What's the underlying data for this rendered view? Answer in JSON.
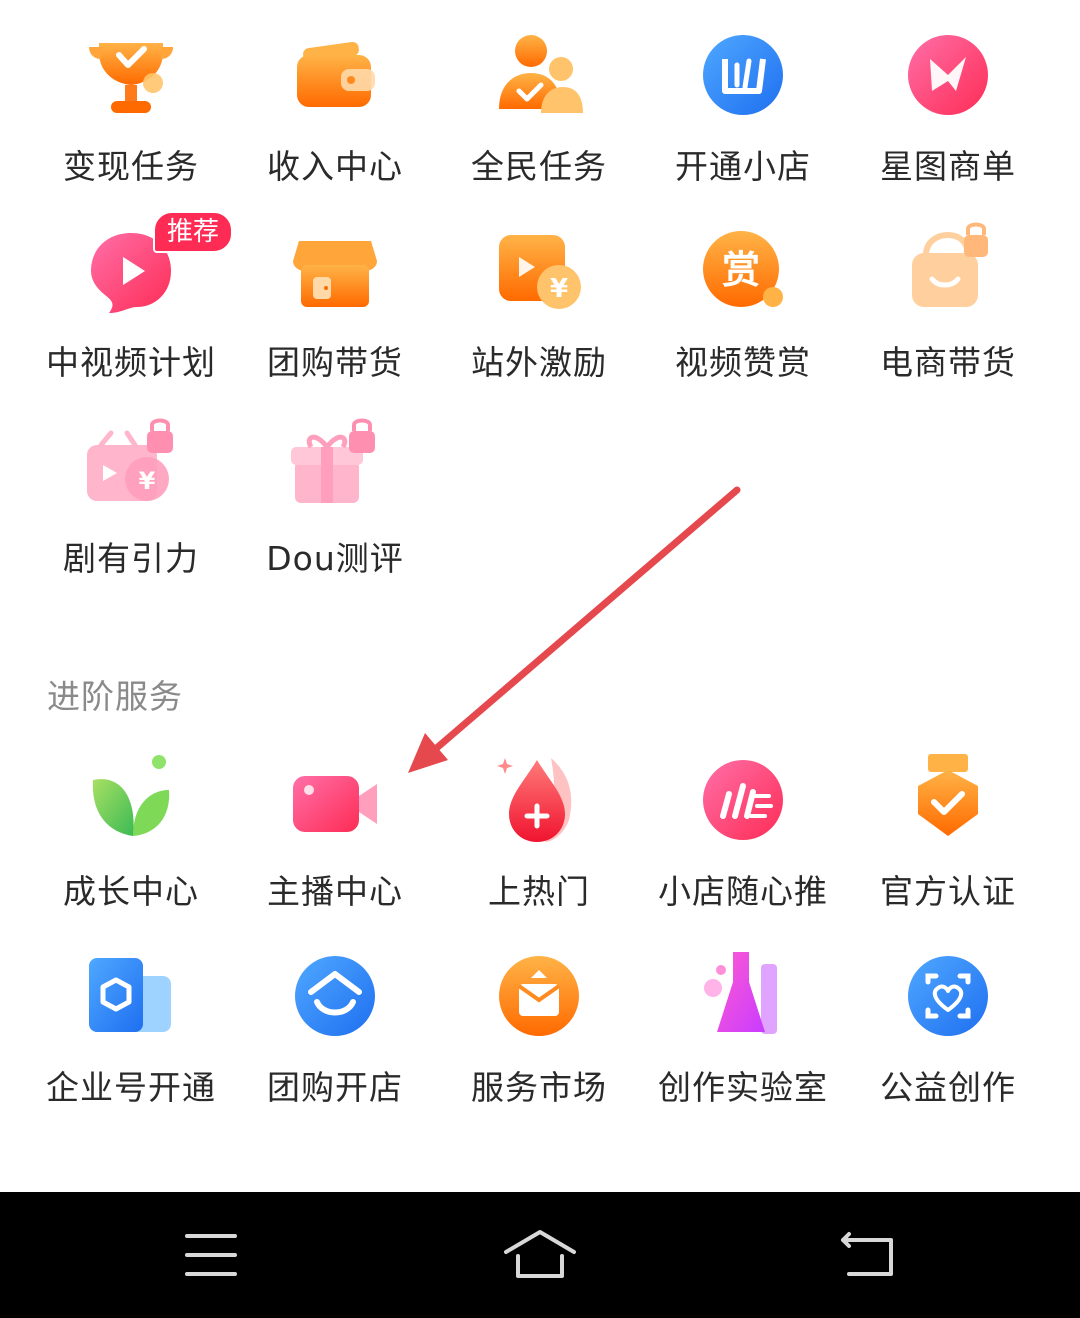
{
  "grid_top": {
    "row1": [
      {
        "label": "变现任务",
        "icon": "trophy-icon"
      },
      {
        "label": "收入中心",
        "icon": "wallet-icon"
      },
      {
        "label": "全民任务",
        "icon": "people-check-icon"
      },
      {
        "label": "开通小店",
        "icon": "shop-logo-icon"
      },
      {
        "label": "星图商单",
        "icon": "star-map-icon"
      }
    ],
    "row2": [
      {
        "label": "中视频计划",
        "icon": "play-bubble-icon",
        "badge": "推荐"
      },
      {
        "label": "团购带货",
        "icon": "storefront-icon"
      },
      {
        "label": "站外激励",
        "icon": "video-yen-icon"
      },
      {
        "label": "视频赞赏",
        "icon": "reward-coin-icon",
        "glyph": "赏"
      },
      {
        "label": "电商带货",
        "icon": "shopping-bag-lock-icon"
      }
    ],
    "row3": [
      {
        "label": "剧有引力",
        "icon": "drama-yen-lock-icon"
      },
      {
        "label": "Dou测评",
        "icon": "gift-lock-icon"
      }
    ]
  },
  "advanced": {
    "title": "进阶服务",
    "row1": [
      {
        "label": "成长中心",
        "icon": "leaf-icon"
      },
      {
        "label": "主播中心",
        "icon": "video-camera-icon"
      },
      {
        "label": "上热门",
        "icon": "flame-drop-icon"
      },
      {
        "label": "小店随心推",
        "icon": "speed-lines-icon"
      },
      {
        "label": "官方认证",
        "icon": "badge-check-icon"
      }
    ],
    "row2": [
      {
        "label": "企业号开通",
        "icon": "enterprise-icon"
      },
      {
        "label": "团购开店",
        "icon": "group-buy-shop-icon"
      },
      {
        "label": "服务市场",
        "icon": "service-market-icon"
      },
      {
        "label": "创作实验室",
        "icon": "flask-lab-icon"
      },
      {
        "label": "公益创作",
        "icon": "charity-heart-icon"
      }
    ]
  },
  "navbar": {
    "menu": "menu-icon",
    "home": "home-icon",
    "back": "back-icon"
  },
  "colors": {
    "accent_red": "#fe2c55",
    "orange": "#ff8a1f",
    "arrow": "#e5484d"
  }
}
